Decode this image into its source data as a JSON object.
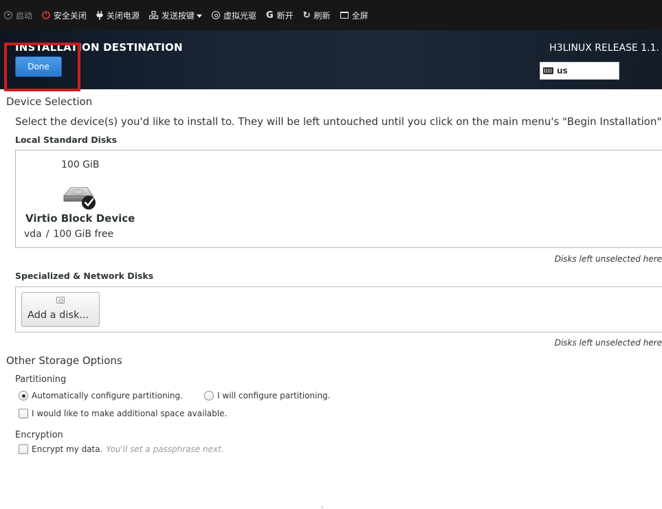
{
  "toolbar": {
    "items": [
      {
        "label": "启动",
        "icon": "play-circle-icon",
        "enabled": false
      },
      {
        "label": "安全关闭",
        "icon": "power-icon",
        "enabled": true
      },
      {
        "label": "关闭电源",
        "icon": "plug-icon",
        "enabled": true
      },
      {
        "label": "发送按键",
        "icon": "keys-icon",
        "enabled": true,
        "dropdown": true
      },
      {
        "label": "虚拟光驱",
        "icon": "disc-icon",
        "enabled": true
      },
      {
        "label": "断开",
        "icon": "disconnect-icon",
        "enabled": true
      },
      {
        "label": "刷新",
        "icon": "refresh-icon",
        "enabled": true
      },
      {
        "label": "全屏",
        "icon": "fullscreen-icon",
        "enabled": true
      }
    ]
  },
  "header": {
    "title": "INSTALLATION DESTINATION",
    "done_label": "Done",
    "release": "H3LINUX RELEASE 1.1.",
    "keyboard_layout": "us"
  },
  "device_selection": {
    "title": "Device Selection",
    "intro": "Select the device(s) you'd like to install to.  They will be left untouched until you click on the main menu's \"Begin Installation\"",
    "local_label": "Local Standard Disks",
    "disk": {
      "size": "100 GiB",
      "name": "Virtio Block Device",
      "device": "vda",
      "separator": "/",
      "free": "100 GiB free",
      "selected": true
    },
    "unselected_note": "Disks left unselected here",
    "special_label": "Specialized & Network Disks",
    "add_disk_label": "Add a disk...",
    "special_unselected_note": "Disks left unselected here"
  },
  "other_storage": {
    "title": "Other Storage Options",
    "partitioning_label": "Partitioning",
    "auto_label": "Automatically configure partitioning.",
    "manual_label": "I will configure partitioning.",
    "space_label": "I would like to make additional space available.",
    "encryption_label": "Encryption",
    "encrypt_label": "Encrypt my data.",
    "encrypt_hint": "You'll set a passphrase next."
  },
  "colors": {
    "accent": "#2a78d2",
    "highlight": "#d01e1e",
    "header_bg": "#1a2535",
    "toolbar_bg": "#171717"
  }
}
